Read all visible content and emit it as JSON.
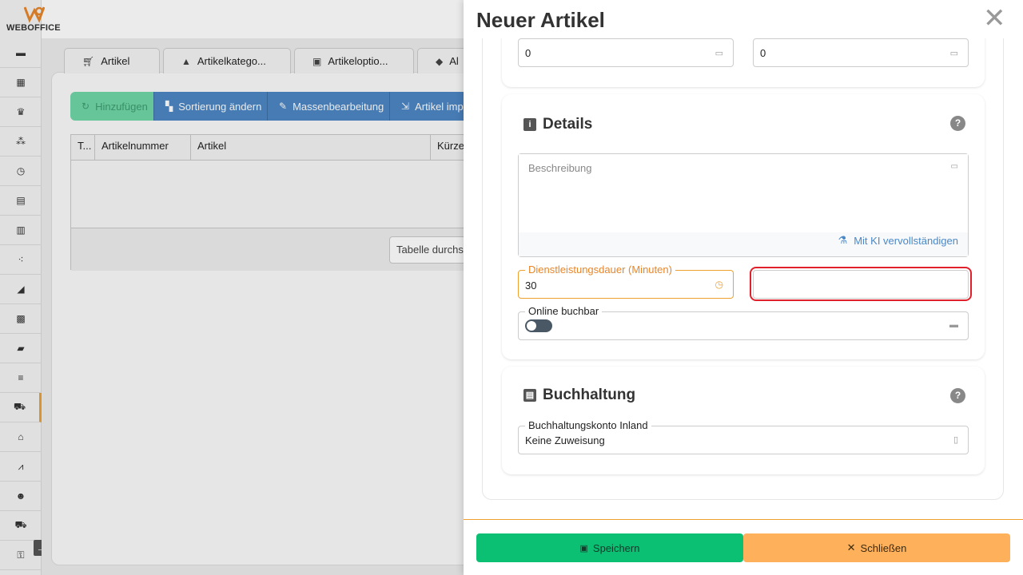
{
  "app": {
    "logo_text": "WEBOFFICE"
  },
  "sidebar": {
    "items": [
      {
        "icon": "calendar-icon",
        "glyph": "▬"
      },
      {
        "icon": "calendar-grid-icon",
        "glyph": "▦"
      },
      {
        "icon": "crown-icon",
        "glyph": "♛"
      },
      {
        "icon": "network-icon",
        "glyph": "⁂"
      },
      {
        "icon": "clock-icon",
        "glyph": "◷"
      },
      {
        "icon": "document-icon",
        "glyph": "▤"
      },
      {
        "icon": "list-document-icon",
        "glyph": "▥"
      },
      {
        "icon": "cubes-icon",
        "glyph": "⁖"
      },
      {
        "icon": "megaphone-icon",
        "glyph": "◢"
      },
      {
        "icon": "chart-icon",
        "glyph": "▩"
      },
      {
        "icon": "folder-icon",
        "glyph": "▰"
      },
      {
        "icon": "database-icon",
        "glyph": "≡"
      },
      {
        "icon": "cart-icon",
        "glyph": "⛟"
      },
      {
        "icon": "warehouse-icon",
        "glyph": "⌂"
      },
      {
        "icon": "line-chart-icon",
        "glyph": "⩘"
      },
      {
        "icon": "users-icon",
        "glyph": "☻"
      },
      {
        "icon": "truck-icon",
        "glyph": "⛟"
      },
      {
        "icon": "key-icon",
        "glyph": "⚿"
      }
    ],
    "active_index": 12
  },
  "background": {
    "tabs": [
      {
        "label": "Artikel",
        "icon": "cart-icon"
      },
      {
        "label": "Artikelkatego...",
        "icon": "shapes-icon"
      },
      {
        "label": "Artikeloptio...",
        "icon": "options-icon"
      },
      {
        "label": "Al",
        "icon": "tag-icon"
      }
    ],
    "buttons": [
      {
        "label": "Hinzufügen",
        "icon": "refresh-icon"
      },
      {
        "label": "Sortierung ändern",
        "icon": "sort-icon"
      },
      {
        "label": "Massenbearbeitung",
        "icon": "pencil-icon"
      },
      {
        "label": "Artikel imp",
        "icon": "import-icon"
      }
    ],
    "table_headers": [
      "T...",
      "Artikelnummer",
      "Artikel",
      "Kürze"
    ],
    "search_placeholder": "Tabelle durchs"
  },
  "drawer": {
    "title": "Neuer Artikel",
    "top_fields": [
      {
        "value": "0"
      },
      {
        "value": "0"
      }
    ],
    "details": {
      "title": "Details",
      "description_placeholder": "Beschreibung",
      "ai_complete": "Mit KI vervollständigen",
      "duration_label": "Dienstleistungsdauer (Minuten)",
      "duration_value": "30",
      "empty_field_value": "",
      "online_label": "Online buchbar"
    },
    "accounting": {
      "title": "Buchhaltung",
      "account_label": "Buchhaltungskonto Inland",
      "account_value": "Keine Zuweisung"
    },
    "footer": {
      "save": "Speichern",
      "close": "Schließen"
    }
  },
  "colors": {
    "accent_orange": "#f0a030",
    "save_green": "#0bbf73",
    "close_orange": "#ffb05a",
    "blue_button": "#4d86c4",
    "highlight_red": "#e0202a"
  }
}
